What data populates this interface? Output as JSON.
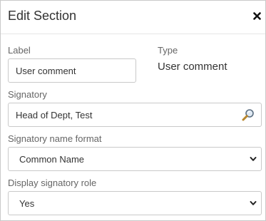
{
  "dialog": {
    "title": "Edit Section"
  },
  "label_field": {
    "label": "Label",
    "value": "User comment"
  },
  "type_field": {
    "label": "Type",
    "value": "User comment"
  },
  "signatory_field": {
    "label": "Signatory",
    "value": "Head of Dept, Test"
  },
  "name_format_field": {
    "label": "Signatory name format",
    "selected": "Common Name"
  },
  "display_role_field": {
    "label": "Display signatory role",
    "selected": "Yes"
  },
  "icons": {
    "close": "close-icon",
    "search": "search-icon",
    "dropdown": "chevron-down-icon"
  }
}
